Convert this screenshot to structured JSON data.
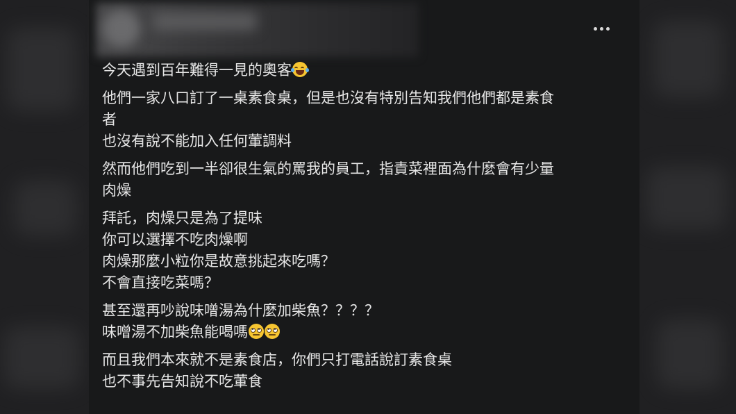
{
  "post": {
    "more_icon": "more-horizontal-icon",
    "paragraphs": [
      {
        "lines": [
          {
            "text": "今天遇到百年難得一見的奧客",
            "emojis": [
              "laughing-crying-emoji"
            ]
          }
        ]
      },
      {
        "lines": [
          {
            "text": "他們一家八口訂了一桌素食桌，但是也沒有特別告知我們他們都是素食"
          },
          {
            "text": "者"
          },
          {
            "text": "也沒有說不能加入任何葷調料"
          }
        ]
      },
      {
        "lines": [
          {
            "text": "然而他們吃到一半卻很生氣的罵我的員工，指責菜裡面為什麼會有少量"
          },
          {
            "text": "肉燥"
          }
        ]
      },
      {
        "lines": [
          {
            "text": "拜託，肉燥只是為了提味"
          },
          {
            "text": "你可以選擇不吃肉燥啊"
          },
          {
            "text": "肉燥那麼小粒你是故意挑起來吃嗎？"
          },
          {
            "text": "不會直接吃菜嗎？"
          }
        ]
      },
      {
        "lines": [
          {
            "text": "甚至還再吵說味噌湯為什麼加柴魚？？？？"
          },
          {
            "text": "味噌湯不加柴魚能喝嗎",
            "emojis": [
              "eye-roll-emoji",
              "eye-roll-emoji"
            ]
          }
        ]
      },
      {
        "lines": [
          {
            "text": "而且我們本來就不是素食店，你們只打電話說訂素食桌"
          },
          {
            "text": "也不事先告知說不吃葷食"
          }
        ]
      }
    ]
  },
  "colors": {
    "background": "#18191a",
    "text": "#e6e6e6",
    "emoji": "#f6c531"
  }
}
